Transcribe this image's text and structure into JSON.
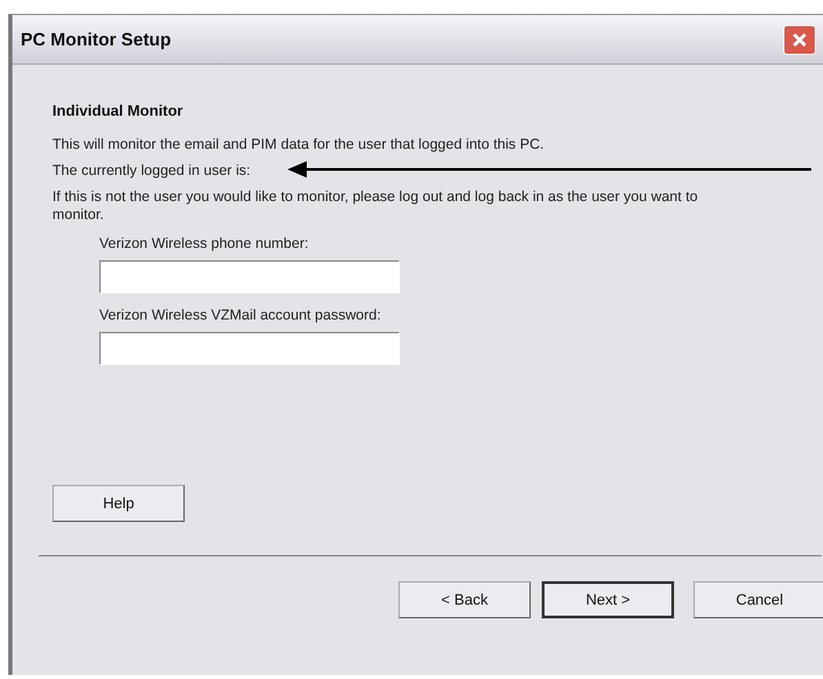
{
  "window": {
    "title": "PC Monitor Setup"
  },
  "heading": "Individual Monitor",
  "paragraphs": [
    "This will monitor the email and PIM data for the user that logged into this PC.",
    "The currently logged in user is:",
    "If this is not the user you would like to monitor, please log out and log back in as the user you want to monitor."
  ],
  "fields": [
    {
      "label": "Verizon Wireless phone number:"
    },
    {
      "label": "Verizon Wireless VZMail account password:"
    }
  ],
  "help_button": "Help",
  "buttons": [
    {
      "label": "< Back",
      "default": false
    },
    {
      "label": "Next >",
      "default": true
    },
    {
      "label": "Cancel",
      "default": false
    }
  ]
}
